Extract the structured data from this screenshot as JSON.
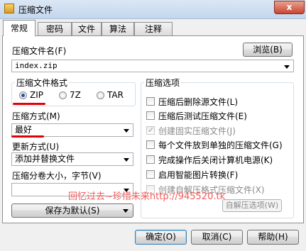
{
  "window": {
    "title": "压缩文件",
    "close_glyph": "x"
  },
  "tabs": [
    {
      "label": "常规",
      "active": true
    },
    {
      "label": "密码"
    },
    {
      "label": "文件"
    },
    {
      "label": "算法"
    },
    {
      "label": "注释"
    }
  ],
  "general": {
    "archive_name_label": "压缩文件名(F)",
    "browse_button": "浏览(B)",
    "archive_name_value": "index.zip",
    "format_group": {
      "title": "压缩文件格式",
      "options": [
        "ZIP",
        "7Z",
        "TAR"
      ],
      "selected": "ZIP"
    },
    "method_label": "压缩方式(M)",
    "method_value": "最好",
    "update_label": "更新方式(U)",
    "update_value": "添加并替换文件",
    "split_label": "压缩分卷大小，字节(V)",
    "split_value": "",
    "save_default_button": "保存为默认(S)",
    "options_group": {
      "title": "压缩选项",
      "items": [
        {
          "label": "压缩后删除源文件(L)",
          "checked": false,
          "disabled": false
        },
        {
          "label": "压缩后测试压缩文件(E)",
          "checked": false,
          "disabled": false
        },
        {
          "label": "创建固实压缩文件(J)",
          "checked": true,
          "disabled": true
        },
        {
          "label": "每个文件放到单独的压缩文件(G)",
          "checked": false,
          "disabled": false
        },
        {
          "label": "完成操作后关闭计算机电源(K)",
          "checked": false,
          "disabled": false
        },
        {
          "label": "启用智能图片转换(F)",
          "checked": false,
          "disabled": false
        },
        {
          "label": "创建自解压格式压缩文件(X)",
          "checked": false,
          "disabled": true
        }
      ],
      "sfx_button": "自解压选项(W)"
    }
  },
  "watermark": "回忆过去~珍惜未来http://945520.tk",
  "footer": {
    "ok": "确定(O)",
    "cancel": "取消(C)",
    "help": "帮助(H)"
  },
  "colors": {
    "accent_red": "#e0000a",
    "radio_dot": "#1f55b0",
    "watermark": "#f25a5a"
  }
}
